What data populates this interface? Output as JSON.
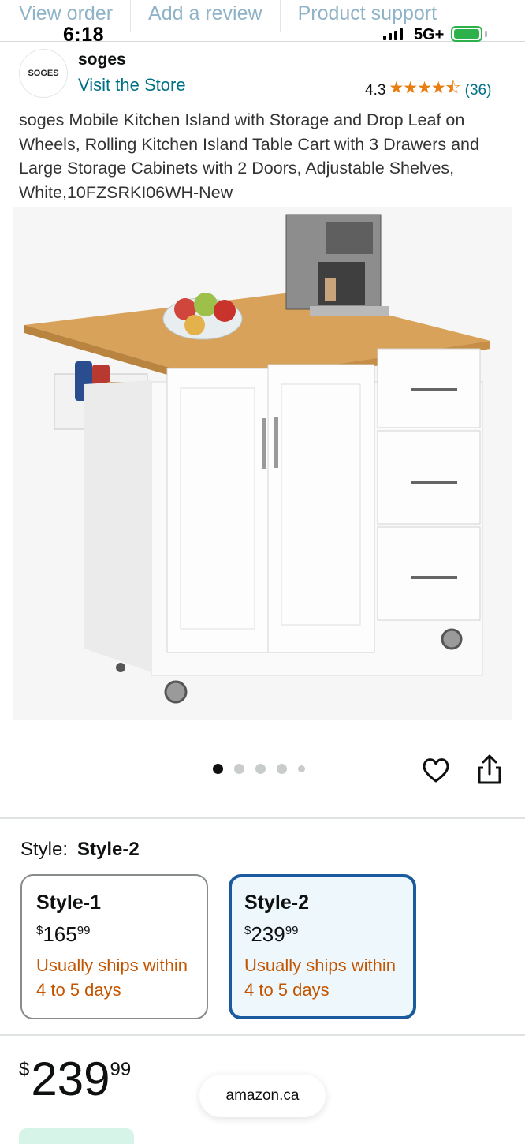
{
  "top_tabs": [
    "View order",
    "Add a review",
    "Product support"
  ],
  "status_bar": {
    "time": "6:18",
    "network": "5G+"
  },
  "brand": {
    "logo_text": "SOGES",
    "name": "soges",
    "visit_store": "Visit the Store",
    "rating": "4.3",
    "stars": "★★★★⯪",
    "review_count": "(36)"
  },
  "product": {
    "title": "soges Mobile Kitchen Island with Storage and Drop Leaf on Wheels, Rolling Kitchen Island Table Cart with 3 Drawers and Large Storage Cabinets with 2 Doors, Adjustable Shelves, White,10FZSRKI06WH-New",
    "image_icon": "kitchen-island-product-image",
    "carousel_index": 1,
    "carousel_total": 5
  },
  "style": {
    "label": "Style:",
    "selected": "Style-2",
    "options": [
      {
        "name": "Style-1",
        "currency": "$",
        "whole": "165",
        "fraction": "99",
        "shipping": "Usually ships within 4 to 5 days",
        "selected": false
      },
      {
        "name": "Style-2",
        "currency": "$",
        "whole": "239",
        "fraction": "99",
        "shipping": "Usually ships within 4 to 5 days",
        "selected": true
      }
    ]
  },
  "price": {
    "currency": "$",
    "whole": "239",
    "fraction": "99"
  },
  "domain_pill": "amazon.ca",
  "colors": {
    "link": "#007185",
    "star": "#e97d12",
    "shipping": "#c45500",
    "selected_border": "#1a5a9e",
    "selected_bg": "#edf7fc"
  }
}
